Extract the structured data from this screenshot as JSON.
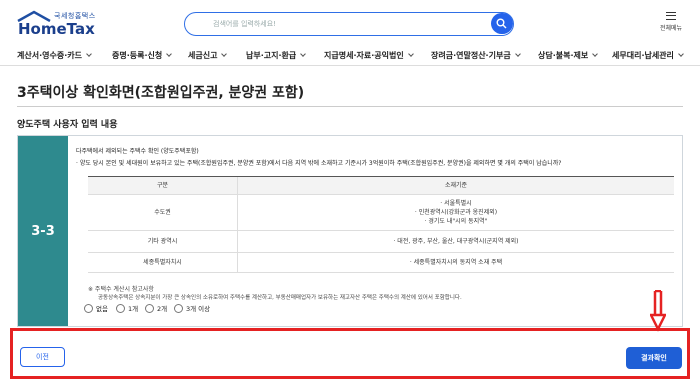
{
  "header": {
    "logo_small": "국세청홈택스",
    "logo_big": "HomeTax",
    "search_placeholder": "검색어를 입력하세요!",
    "menu_label": "전체메뉴"
  },
  "nav": [
    "계산서·영수증·카드",
    "증명·등록·신청",
    "세금신고",
    "납부·고지·환급",
    "지급명세·자료·공익법인",
    "장려금·연말정산·기부금",
    "상담·불복·제보",
    "세무대리·납세관리"
  ],
  "page_title": "3주택이상 확인화면(조합원입주권, 분양권 포함)",
  "section_title": "양도주택 사용자 입력 내용",
  "step_number": "3-3",
  "question": {
    "title": "다주택에서 제외되는 주택수 확인 (양도주택포함)",
    "text": "· 양도 당시 본인 및 세대원이 보유하고 있는 주택(조합원입주권, 분양권 포함)에서 다음 지역 밖에 소재하고 기준시가 3억원이하 주택(조합원입주권, 분양권)을 제외하면 몇 개의 주택이 남습니까?"
  },
  "table": {
    "headers": [
      "구분",
      "소재기준"
    ],
    "rows": [
      {
        "label": "수도권",
        "lines": [
          "· 서울특별시",
          "· 인천광역시(강화군과 옹진제외)",
          "· 경기도 내\"시의 동지역\""
        ]
      },
      {
        "label": "기타 광역시",
        "lines": [
          "· 대전, 광주, 부산, 울산, 대구광역시(군지역 제외)"
        ]
      },
      {
        "label": "세종특별자치시",
        "lines": [
          "· 세종특별자치시의 동지역 소재 주택"
        ]
      }
    ]
  },
  "note": {
    "title": "※ 주택수 계산시 참고사항",
    "text": "공동상속주택은 상속지분이 가장 큰 상속인의 소유로하여 주택수를 계산하고, 부동산매매업자가 보유하는 재고자산 주택은 주택수의 계산에 있어서 포함합니다."
  },
  "options": [
    "없음",
    "1개",
    "2개",
    "3개 이상"
  ],
  "buttons": {
    "prev": "이전",
    "result": "결과확인"
  },
  "colors": {
    "step_bg": "#2e8a8e",
    "primary": "#1f5fd6",
    "highlight": "#e52222"
  }
}
